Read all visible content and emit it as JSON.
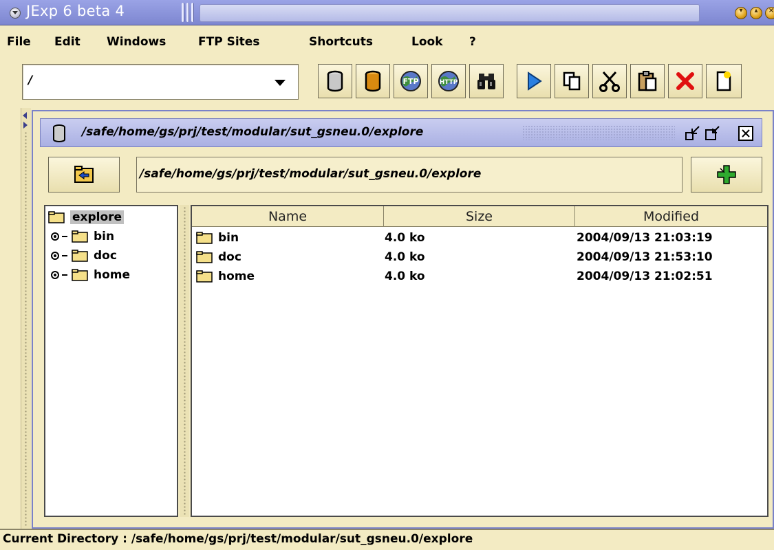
{
  "window": {
    "title": "JExp 6 beta 4",
    "menu_icon": "window-menu-icon",
    "controls": [
      "minimize-icon",
      "maximize-icon",
      "close-icon"
    ]
  },
  "menubar": {
    "items": [
      "File",
      "Edit",
      "Windows",
      "FTP Sites",
      "Shortcuts",
      "Look",
      "?"
    ]
  },
  "toolbar": {
    "location_value": "/",
    "buttons": [
      {
        "icon": "local-disk-icon"
      },
      {
        "icon": "remote-disk-icon"
      },
      {
        "icon": "ftp-globe-icon",
        "label": "FTP"
      },
      {
        "icon": "http-globe-icon",
        "label": "HTTP"
      },
      {
        "icon": "binoculars-icon"
      },
      {
        "icon": "play-arrow-icon"
      },
      {
        "icon": "copy-icon"
      },
      {
        "icon": "cut-scissors-icon"
      },
      {
        "icon": "paste-icon"
      },
      {
        "icon": "delete-x-icon"
      },
      {
        "icon": "new-file-icon"
      }
    ]
  },
  "explorer": {
    "frame_title": "/safe/home/gs/prj/test/modular/sut_gsneu.0/explore",
    "path_value": "/safe/home/gs/prj/test/modular/sut_gsneu.0/explore",
    "tree": {
      "root": "explore",
      "children": [
        "bin",
        "doc",
        "home"
      ]
    },
    "table": {
      "columns": [
        "Name",
        "Size",
        "Modified"
      ],
      "rows": [
        {
          "name": "bin",
          "size": "4.0 ko",
          "modified": "2004/09/13 21:03:19"
        },
        {
          "name": "doc",
          "size": "4.0 ko",
          "modified": "2004/09/13 21:53:10"
        },
        {
          "name": "home",
          "size": "4.0 ko",
          "modified": "2004/09/13 21:02:51"
        }
      ]
    }
  },
  "status": {
    "text": "Current Directory : /safe/home/gs/prj/test/modular/sut_gsneu.0/explore"
  },
  "colors": {
    "background": "#f3ebc3",
    "titlebar": "#8a93dc",
    "frame_border": "#7a82c8"
  }
}
